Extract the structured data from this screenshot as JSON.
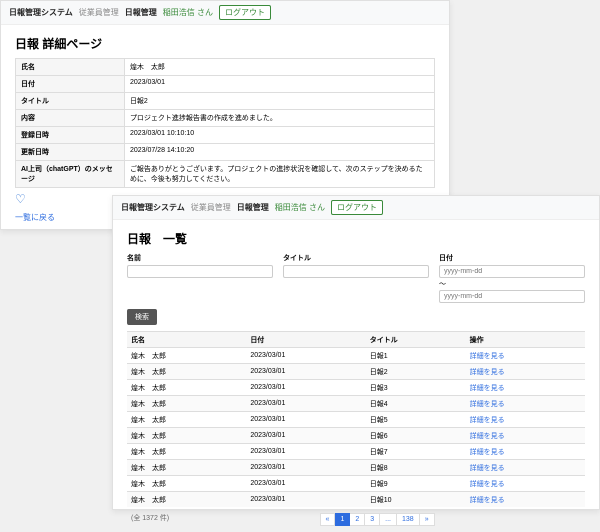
{
  "nav": {
    "brand": "日報管理システム",
    "link_employees": "従業員管理",
    "link_reports": "日報管理",
    "user_name": "稲田浩信 さん",
    "logout": "ログアウト"
  },
  "detail": {
    "page_title": "日報 詳細ページ",
    "labels": {
      "name": "氏名",
      "date": "日付",
      "title": "タイトル",
      "content": "内容",
      "created": "登録日時",
      "updated": "更新日時",
      "ai_msg": "AI上司（chatGPT）のメッセージ"
    },
    "values": {
      "name": "煌木　太郎",
      "date": "2023/03/01",
      "title": "日報2",
      "content": "プロジェクト進捗報告書の作成を進めました。",
      "created": "2023/03/01 10:10:10",
      "updated": "2023/07/28 14:10:20",
      "ai_msg": "ご報告ありがとうございます。プロジェクトの進捗状況を確認して、次のステップを決めるために、今後も努力してください。"
    },
    "heart_icon": "♡",
    "back_link": "一覧に戻る"
  },
  "list": {
    "page_title": "日報　一覧",
    "search": {
      "name_label": "名前",
      "title_label": "タイトル",
      "date_label": "日付",
      "date_placeholder": "yyyy-mm-dd",
      "tilde": "～",
      "button": "検索"
    },
    "headers": {
      "name": "氏名",
      "date": "日付",
      "title": "タイトル",
      "action": "操作"
    },
    "detail_link_label": "詳細を見る",
    "rows": [
      {
        "name": "煌木　太郎",
        "date": "2023/03/01",
        "title": "日報1"
      },
      {
        "name": "煌木　太郎",
        "date": "2023/03/01",
        "title": "日報2"
      },
      {
        "name": "煌木　太郎",
        "date": "2023/03/01",
        "title": "日報3"
      },
      {
        "name": "煌木　太郎",
        "date": "2023/03/01",
        "title": "日報4"
      },
      {
        "name": "煌木　太郎",
        "date": "2023/03/01",
        "title": "日報5"
      },
      {
        "name": "煌木　太郎",
        "date": "2023/03/01",
        "title": "日報6"
      },
      {
        "name": "煌木　太郎",
        "date": "2023/03/01",
        "title": "日報7"
      },
      {
        "name": "煌木　太郎",
        "date": "2023/03/01",
        "title": "日報8"
      },
      {
        "name": "煌木　太郎",
        "date": "2023/03/01",
        "title": "日報9"
      },
      {
        "name": "煌木　太郎",
        "date": "2023/03/01",
        "title": "日報10"
      }
    ],
    "pager": {
      "count": "(全 1372 件)",
      "pages": [
        "«",
        "1",
        "2",
        "3",
        "...",
        "138",
        "»"
      ],
      "active_index": 1
    }
  }
}
